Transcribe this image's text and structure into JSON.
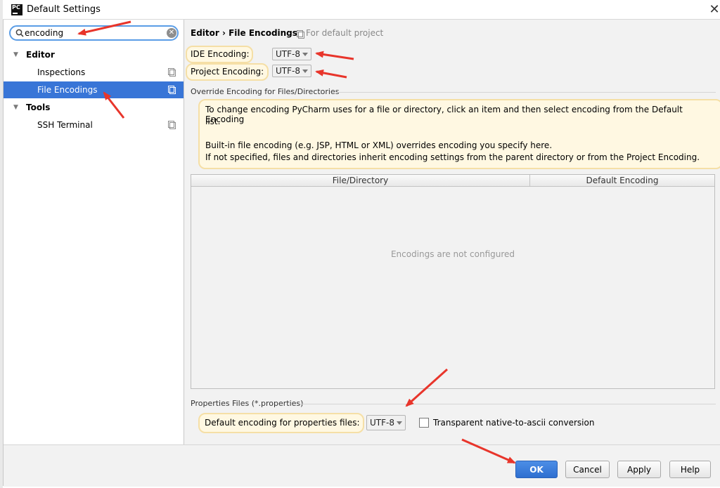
{
  "window": {
    "title": "Default Settings",
    "app_icon_text": "PC",
    "close_glyph": "✕"
  },
  "sidebar": {
    "search_value": "encoding",
    "search_clear_glyph": "✕",
    "items": [
      {
        "label": "Editor",
        "arrow": "▼"
      },
      {
        "label": "Inspections"
      },
      {
        "label": "File Encodings",
        "selected": true
      },
      {
        "label": "Tools",
        "arrow": "▼"
      },
      {
        "label": "SSH Terminal"
      }
    ]
  },
  "content": {
    "breadcrumb": "Editor › File Encodings",
    "breadcrumb_sub": "For default project",
    "ide_encoding_label": "IDE Encoding:",
    "ide_encoding_value": "UTF-8",
    "project_encoding_label": "Project Encoding:",
    "project_encoding_value": "UTF-8",
    "override_section_title": "Override Encoding for Files/Directories",
    "info_lines": [
      "To change encoding PyCharm uses for a file or directory, click an item and then select encoding from the Default Encoding",
      "list.",
      "Built-in file encoding (e.g. JSP, HTML or XML) overrides encoding you specify here.",
      "If not specified, files and directories inherit encoding settings from the parent directory or from the Project Encoding."
    ],
    "table": {
      "columns": [
        "File/Directory",
        "Default Encoding"
      ],
      "empty_text": "Encodings are not configured"
    },
    "properties_section_title": "Properties Files (*.properties)",
    "properties_label": "Default encoding for properties files:",
    "properties_value": "UTF-8",
    "transparent_label": "Transparent native-to-ascii conversion"
  },
  "footer": {
    "ok": "OK",
    "cancel": "Cancel",
    "apply": "Apply",
    "help": "Help"
  },
  "colors": {
    "accent": "#3875d7",
    "highlight": "#f5dfa6",
    "annotation_arrow": "#e8352b"
  }
}
